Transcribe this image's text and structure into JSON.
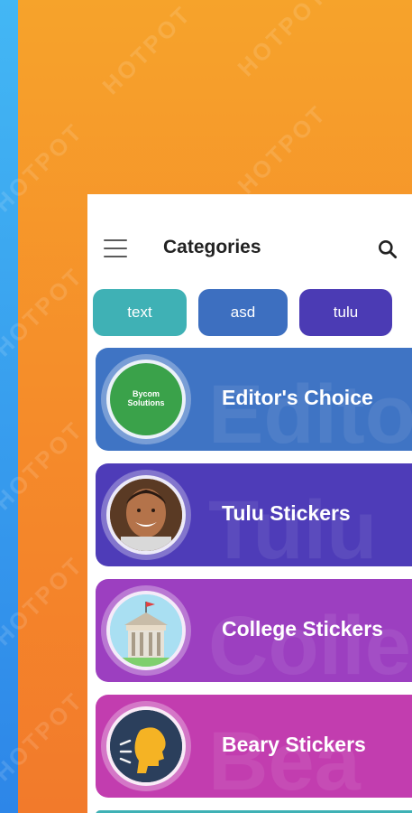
{
  "app": {
    "title": "Categories"
  },
  "icons": {
    "menu": "hamburger-menu-icon",
    "search": "search-icon"
  },
  "chips": [
    {
      "label": "text",
      "color": "#3fb1b5"
    },
    {
      "label": "asd",
      "color": "#3d6fc0"
    },
    {
      "label": "tulu",
      "color": "#4b3bb4"
    }
  ],
  "categories": [
    {
      "label": "Editor's Choice",
      "bg_word": "Edito",
      "color": "#3f74c4",
      "avatar_text": "Bycom Solutions"
    },
    {
      "label": "Tulu Stickers",
      "bg_word": "Tulu",
      "color": "#4e3cb8"
    },
    {
      "label": "College Stickers",
      "bg_word": "Colle",
      "color": "#9c3fc0"
    },
    {
      "label": "Beary Stickers",
      "bg_word": "Bea",
      "color": "#c23daf"
    }
  ],
  "watermark": "HOTPOT"
}
